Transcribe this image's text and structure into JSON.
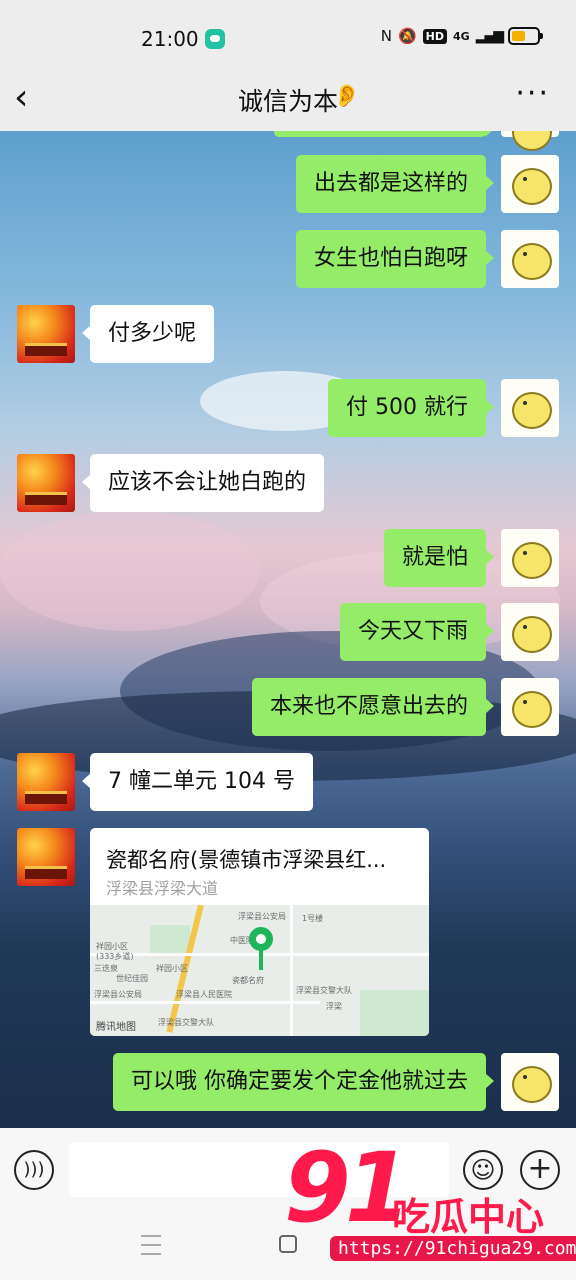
{
  "status_bar": {
    "time": "21:00",
    "network": "4G",
    "hd_label": "HD",
    "battery_level": 0.55,
    "icons": [
      "nfc-icon",
      "mute-bell-icon",
      "hd-icon",
      "signal-icon",
      "battery-icon"
    ]
  },
  "header": {
    "title": "诚信为本",
    "icons": [
      "back-icon",
      "ear-icon",
      "more-icon"
    ]
  },
  "messages": [
    {
      "from": "self",
      "text": "出去都是这样的"
    },
    {
      "from": "self",
      "text": "女生也怕白跑呀"
    },
    {
      "from": "other",
      "text": "付多少呢"
    },
    {
      "from": "self",
      "text": "付 500 就行"
    },
    {
      "from": "other",
      "text": "应该不会让她白跑的"
    },
    {
      "from": "self",
      "text": "就是怕"
    },
    {
      "from": "self",
      "text": "今天又下雨"
    },
    {
      "from": "self",
      "text": "本来也不愿意出去的"
    },
    {
      "from": "other",
      "text": "7 幢二单元 104 号"
    },
    {
      "from": "other",
      "type": "location",
      "title": "瓷都名府(景德镇市浮梁县红...",
      "address": "浮梁县浮梁大道",
      "map_credit": "腾讯地图",
      "map_labels": [
        "浮梁县公安局",
        "浮梁县交警大队",
        "祥园小区",
        "(333乡道)",
        "三迭泉",
        "世纪佳园",
        "浮梁县公安局",
        "浮梁县人民医院",
        "中医院",
        "祥园小区",
        "1号楼",
        "浮梁县交警大队",
        "瓷都名府",
        "浮梁"
      ]
    },
    {
      "from": "self",
      "text": "可以哦 你确定要发个定金他就过去"
    }
  ],
  "input_bar": {
    "placeholder": "",
    "icons": [
      "voice-icon",
      "emoji-icon",
      "plus-icon"
    ]
  },
  "watermark": {
    "number": "91",
    "name": "吃瓜中心",
    "url": "https://91chigua29.com"
  },
  "colors": {
    "self_bubble": "#95ec69",
    "other_bubble": "#ffffff",
    "header_bg": "#ededed",
    "watermark": "#ff1a4b"
  }
}
